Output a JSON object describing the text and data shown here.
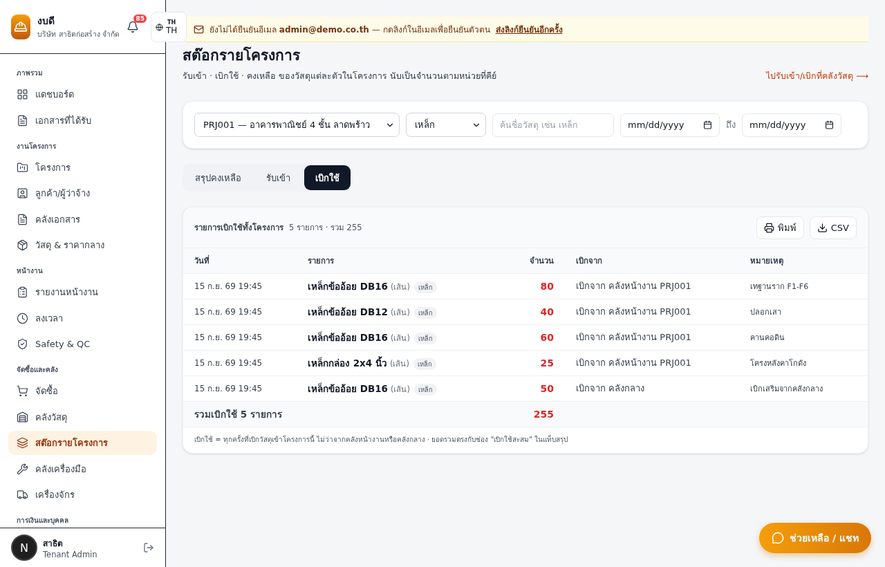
{
  "brand": {
    "name": "งบดี",
    "company": "บริษัท สาธิตก่อสร้าง จำกัด",
    "notifications": "85"
  },
  "language": {
    "small": "TH",
    "label": "TH"
  },
  "sidebar": {
    "sections": [
      {
        "title": "ภาพรวม",
        "items": [
          {
            "label": "แดชบอร์ด",
            "selected": false
          },
          {
            "label": "เอกสารที่ได้รับ",
            "selected": false
          }
        ]
      },
      {
        "title": "งานโครงการ",
        "items": [
          {
            "label": "โครงการ",
            "selected": false
          },
          {
            "label": "ลูกค้า/ผู้ว่าจ้าง",
            "selected": false
          },
          {
            "label": "คลังเอกสาร",
            "selected": false
          },
          {
            "label": "วัสดุ & ราคากลาง",
            "selected": false
          }
        ]
      },
      {
        "title": "หน้างาน",
        "items": [
          {
            "label": "รายงานหน้างาน",
            "selected": false
          },
          {
            "label": "ลงเวลา",
            "selected": false
          },
          {
            "label": "Safety & QC",
            "selected": false
          }
        ]
      },
      {
        "title": "จัดซื้อและคลัง",
        "items": [
          {
            "label": "จัดซื้อ",
            "selected": false
          },
          {
            "label": "คลังวัสดุ",
            "selected": false
          },
          {
            "label": "สต๊อกรายโครงการ",
            "selected": true
          },
          {
            "label": "คลังเครื่องมือ",
            "selected": false
          },
          {
            "label": "เครื่องจักร",
            "selected": false
          }
        ]
      },
      {
        "title": "การเงินและบุคคล"
      }
    ]
  },
  "user": {
    "avatar": "N",
    "name": "สาธิต",
    "role": "Tenant Admin"
  },
  "banner": {
    "text": "ยังไม่ได้ยืนยันอีเมล **admin@demo.co.th** — กดลิงก์ในอีเมลเพื่อยืนยันตัวตน",
    "link": "ส่งลิงก์ยืนยันอีกครั้ง"
  },
  "page": {
    "title": "สต๊อกรายโครงการ",
    "subtitle": "รับเข้า · เบิกใช้ · คงเหลือ ของวัสดุแต่ละตัวในโครงการ นับเป็นจำนวนตามหน่วยที่คีย์",
    "link": "ไปรับเข้า/เบิกที่คลังวัสดุ ⟶"
  },
  "filters": {
    "project": "PRJ001 — อาคารพาณิชย์ 4 ชั้น ลาดพร้าว",
    "category": "เหล็ก",
    "search_placeholder": "ค้นชื่อวัสดุ เช่น เหล็ก",
    "date_from_placeholder": "mm/dd/yyyy",
    "to_label": "ถึง",
    "date_to_placeholder": "mm/dd/yyyy"
  },
  "tabs": [
    {
      "label": "สรุปคงเหลือ",
      "selected": false
    },
    {
      "label": "รับเข้า",
      "selected": false
    },
    {
      "label": "เบิกใช้",
      "selected": true
    }
  ],
  "table": {
    "title": "รายการเบิกใช้ทั้งโครงการ",
    "summary": "5 รายการ · รวม 255",
    "buttons": [
      "พิมพ์",
      "CSV"
    ],
    "columns": [
      "วันที่",
      "รายการ",
      "จำนวน",
      "เบิกจาก",
      "หมายเหตุ"
    ],
    "rows": [
      {
        "date": "15 ก.ย. 69 19:45",
        "item": "เหล็กข้ออ้อย DB16",
        "unit": "(เส้น)",
        "tag": "เหล็ก",
        "qty": "80",
        "source": "เบิกจาก คลังหน้างาน PRJ001",
        "note": "เทฐานราก F1-F6"
      },
      {
        "date": "15 ก.ย. 69 19:45",
        "item": "เหล็กข้ออ้อย DB12",
        "unit": "(เส้น)",
        "tag": "เหล็ก",
        "qty": "40",
        "source": "เบิกจาก คลังหน้างาน PRJ001",
        "note": "ปลอกเสา"
      },
      {
        "date": "15 ก.ย. 69 19:45",
        "item": "เหล็กข้ออ้อย DB16",
        "unit": "(เส้น)",
        "tag": "เหล็ก",
        "qty": "60",
        "source": "เบิกจาก คลังหน้างาน PRJ001",
        "note": "คานคอดิน"
      },
      {
        "date": "15 ก.ย. 69 19:45",
        "item": "เหล็กกล่อง 2x4 นิ้ว",
        "unit": "(เส้น)",
        "tag": "เหล็ก",
        "qty": "25",
        "source": "เบิกจาก คลังหน้างาน PRJ001",
        "note": "โครงหลังคาโกดัง"
      },
      {
        "date": "15 ก.ย. 69 19:45",
        "item": "เหล็กข้ออ้อย DB16",
        "unit": "(เส้น)",
        "tag": "เหล็ก",
        "qty": "50",
        "source": "เบิกจาก คลังกลาง",
        "note": "เบิกเสริมจากคลังกลาง"
      }
    ],
    "total_label": "รวมเบิกใช้ 5 รายการ",
    "total": "255",
    "footnote": "เบิกใช้ = ทุกครั้งที่เบิกวัสดุเข้าโครงการนี้ ไม่ว่าจากคลังหน้างานหรือคลังกลาง · ยอดรวมตรงกับช่อง \"เบิกใช้สะสม\" ในแท็บสรุป"
  },
  "help_button": "ช่วยเหลือ / แชท"
}
